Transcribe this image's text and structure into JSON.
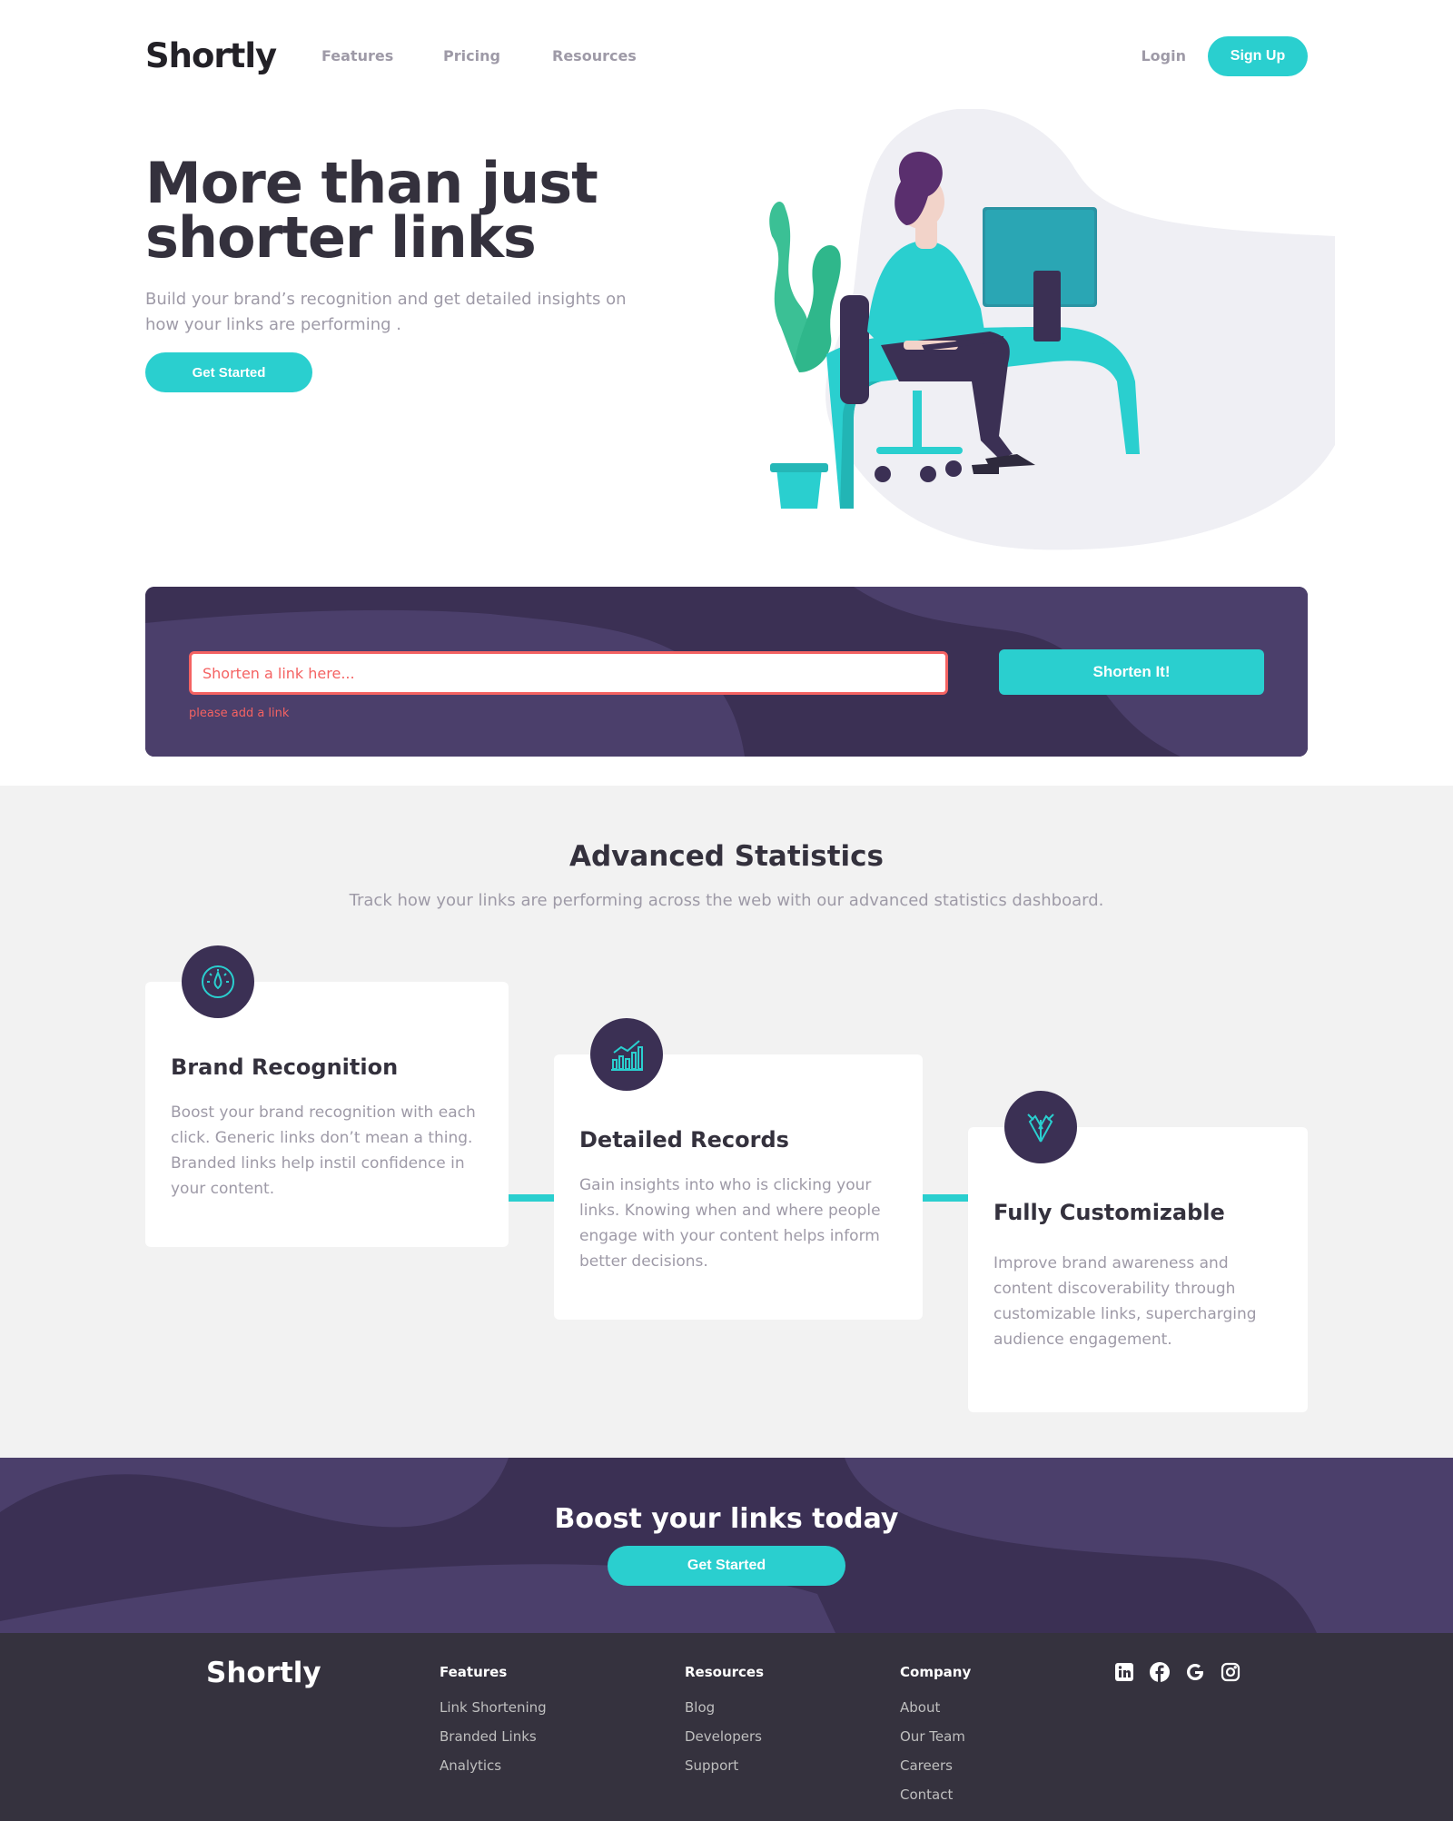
{
  "header": {
    "logo": "Shortly",
    "nav": [
      "Features",
      "Pricing",
      "Resources"
    ],
    "login": "Login",
    "signup": "Sign Up"
  },
  "hero": {
    "title": "More than just shorter links",
    "subtitle": "Build your brand’s recognition and get detailed insights on how your links are performing .",
    "cta": "Get Started"
  },
  "shorten": {
    "placeholder": "Shorten a link here...",
    "error": "please add a link",
    "button": "Shorten It!"
  },
  "stats": {
    "title": "Advanced Statistics",
    "subtitle": "Track how your links are performing across the web with our advanced statistics dashboard.",
    "cards": [
      {
        "icon": "gauge-icon",
        "title": "Brand Recognition",
        "text": "Boost your brand recognition with each click. Generic links don’t mean a thing. Branded links help instil confidence in your content."
      },
      {
        "icon": "bar-chart-icon",
        "title": "Detailed Records",
        "text": "Gain insights into who is clicking your links. Knowing when and where people engage with your content helps inform better decisions."
      },
      {
        "icon": "brush-pen-icon",
        "title": "Fully Customizable",
        "text": "Improve brand awareness and content discoverability through customizable links, supercharging audience engagement."
      }
    ]
  },
  "boost": {
    "title": "Boost your links today",
    "cta": "Get Started"
  },
  "footer": {
    "logo": "Shortly",
    "columns": [
      {
        "title": "Features",
        "links": [
          "Link Shortening",
          "Branded Links",
          "Analytics"
        ]
      },
      {
        "title": "Resources",
        "links": [
          "Blog",
          "Developers",
          "Support"
        ]
      },
      {
        "title": "Company",
        "links": [
          "About",
          "Our Team",
          "Careers",
          "Contact"
        ]
      }
    ],
    "socials": [
      "linkedin-icon",
      "facebook-icon",
      "google-icon",
      "instagram-icon"
    ]
  },
  "colors": {
    "cyan": "#2acfcf",
    "dark_violet": "#3b3054",
    "red": "#f46262",
    "gray": "#9e9aa7",
    "very_dark": "#35323e"
  }
}
